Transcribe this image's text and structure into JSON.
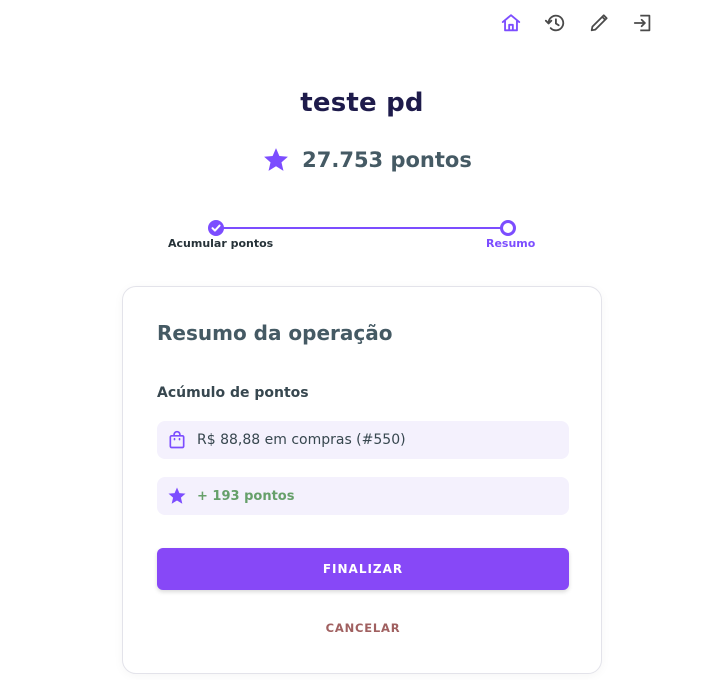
{
  "nav": {
    "items": [
      {
        "icon": "home-icon",
        "active": true
      },
      {
        "icon": "history-icon",
        "active": false
      },
      {
        "icon": "edit-icon",
        "active": false
      },
      {
        "icon": "logout-icon",
        "active": false
      }
    ]
  },
  "user": {
    "name": "teste pd",
    "points": "27.753 pontos"
  },
  "stepper": {
    "steps": [
      {
        "label": "Acumular pontos",
        "status": "done"
      },
      {
        "label": "Resumo",
        "status": "current"
      }
    ]
  },
  "summary": {
    "title": "Resumo da operação",
    "section_label": "Acúmulo de pontos",
    "purchase_text": "R$ 88,88 em compras (#550)",
    "points_gain": "+ 193 pontos",
    "finalize_label": "FINALIZAR",
    "cancel_label": "CANCELAR"
  },
  "colors": {
    "accent": "#7c4dff",
    "button": "#8748f7",
    "gain_text": "#66a06a",
    "cancel_text": "#a06060"
  }
}
